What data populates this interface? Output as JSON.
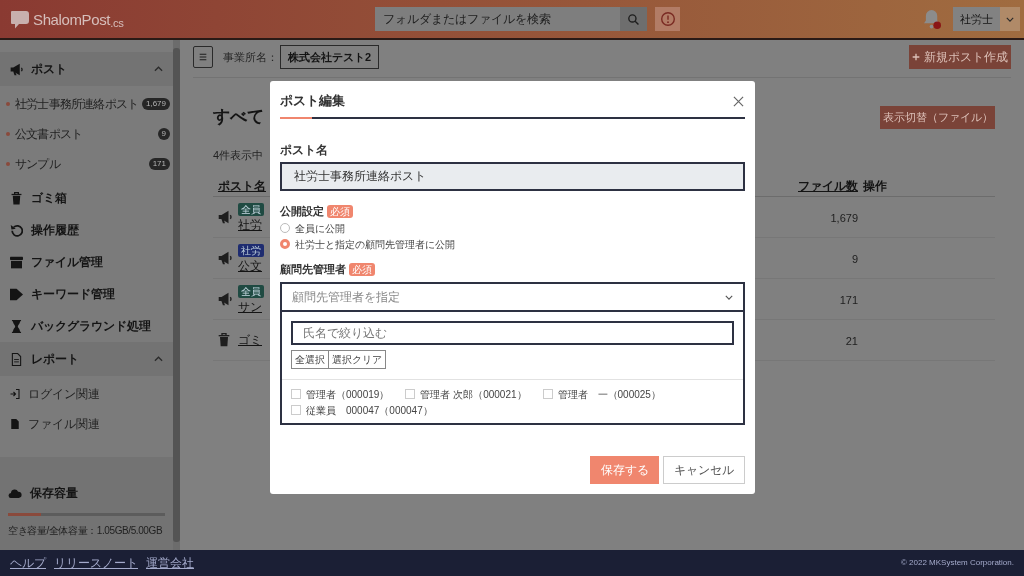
{
  "header": {
    "logo": "ShalomPost$_{.cs}$",
    "search": {
      "placeholder": "フォルダまたはファイルを検索"
    },
    "user_menu": "社労士"
  },
  "sidebar": {
    "items": [
      {
        "kind": "group",
        "label": "ポスト",
        "expanded": true,
        "children": [
          {
            "kind": "post",
            "label": "社労士事務所連絡ポスト",
            "count": "1,679"
          },
          {
            "kind": "post",
            "label": "公文書ポスト",
            "count": "9"
          },
          {
            "kind": "post",
            "label": "サンプル",
            "count": "171"
          }
        ]
      },
      {
        "kind": "link",
        "label": "ゴミ箱"
      },
      {
        "kind": "link",
        "label": "操作履歴"
      },
      {
        "kind": "link",
        "label": "ファイル管理"
      },
      {
        "kind": "link",
        "label": "キーワード管理"
      },
      {
        "kind": "link",
        "label": "バックグラウンド処理"
      },
      {
        "kind": "group",
        "label": "レポート",
        "expanded": true,
        "children": [
          {
            "kind": "report",
            "label": "ログイン関連"
          },
          {
            "kind": "report",
            "label": "ファイル関連"
          }
        ]
      }
    ],
    "storage": {
      "title": "保存容量",
      "level": 0.21,
      "caption": "空き容量/全体容量：1.05GB/5.00GB"
    }
  },
  "toolbar": {
    "office_label": "事業所名：",
    "office_name": "株式会社テスト2",
    "new_button": "新規ポスト作成"
  },
  "content": {
    "title": "すべて",
    "view_toggle": "表示切替（ファイル）",
    "result_count": "4件表示中",
    "table": {
      "columns": [
        {
          "label": "ポスト名",
          "sortable": true
        },
        {
          "label": "ファイル数",
          "sortable": true
        },
        {
          "label": "操作",
          "sortable": false
        }
      ],
      "rows": [
        {
          "kind": "post",
          "tag": "全員",
          "color": "#1f4a42",
          "name": "社労",
          "files": "1,679"
        },
        {
          "kind": "post",
          "tag": "社労",
          "color": "#1e2c70",
          "name": "公文",
          "files": "9"
        },
        {
          "kind": "post",
          "tag": "全員",
          "color": "#1f4a42",
          "name": "サン",
          "files": "171"
        },
        {
          "kind": "trash",
          "name": "ゴミ",
          "files": "21"
        }
      ]
    }
  },
  "modal": {
    "title": "ポスト編集",
    "post_name": {
      "label": "ポスト名",
      "value": "社労士事務所連絡ポスト",
      "disabled": true
    },
    "visibility": {
      "label": "公開設定",
      "required": "必須",
      "options": [
        {
          "label": "全員に公開",
          "selected": false
        },
        {
          "label": "社労士と指定の顧問先管理者に公開",
          "selected": true
        }
      ]
    },
    "managers": {
      "label": "顧問先管理者",
      "required": "必須",
      "select": {
        "placeholder": "顧問先管理者を指定",
        "expanded": true
      },
      "filter": {
        "placeholder": "氏名で絞り込む"
      },
      "actions": [
        "全選択",
        "選択クリア"
      ],
      "options": [
        {
          "label": "管理者（000019）",
          "checked": false
        },
        {
          "label": "管理者 次郎（000021）",
          "checked": false
        },
        {
          "label": "管理者　一（000025）",
          "checked": false
        },
        {
          "label": "従業員　000047（000047）",
          "checked": false
        }
      ]
    },
    "buttons": [
      {
        "kind": "primary",
        "label": "保存する"
      },
      {
        "kind": "secondary",
        "label": "キャンセル"
      }
    ]
  },
  "footer": {
    "links": [
      "ヘルプ",
      "リリースノート",
      "運営会社"
    ],
    "copyright": "© 2022 MKSystem Corporation."
  }
}
